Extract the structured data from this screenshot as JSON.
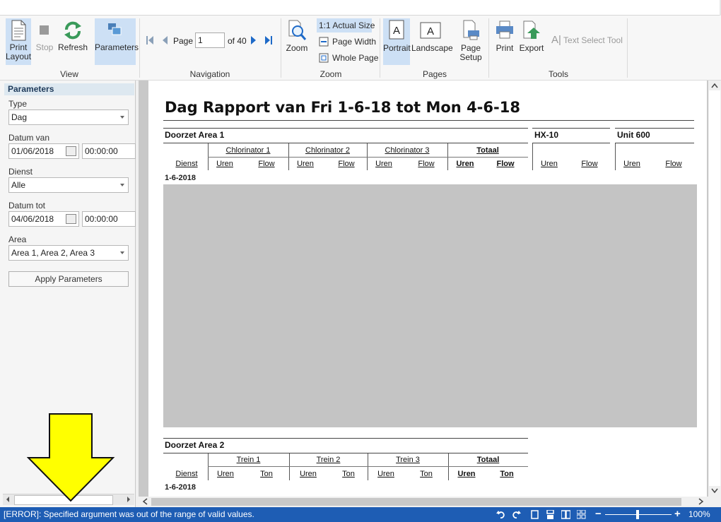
{
  "ribbon": {
    "groups": {
      "view": "View",
      "navigation": "Navigation",
      "zoom": "Zoom",
      "pages": "Pages",
      "tools": "Tools"
    },
    "print_layout_l1": "Print",
    "print_layout_l2": "Layout",
    "stop": "Stop",
    "refresh": "Refresh",
    "parameters": "Parameters",
    "page_label": "Page",
    "page_value": "1",
    "page_of": "of 40",
    "zoom": "Zoom",
    "actual_size": "1:1 Actual Size",
    "page_width": "Page Width",
    "whole_page": "Whole Page",
    "portrait": "Portrait",
    "landscape": "Landscape",
    "page_setup_l1": "Page",
    "page_setup_l2": "Setup",
    "print": "Print",
    "export": "Export",
    "text_select": "Text Select Tool"
  },
  "params": {
    "header": "Parameters",
    "type_label": "Type",
    "type_value": "Dag",
    "datum_van_label": "Datum van",
    "datum_van_date": "01/06/2018",
    "datum_van_time": "00:00:00",
    "dienst_label": "Dienst",
    "dienst_value": "Alle",
    "datum_tot_label": "Datum tot",
    "datum_tot_date": "04/06/2018",
    "datum_tot_time": "00:00:00",
    "area_label": "Area",
    "area_value": "Area 1, Area 2, Area 3",
    "apply": "Apply Parameters"
  },
  "report": {
    "title": "Dag Rapport van Fri 1-6-18 tot Mon 4-6-18",
    "section1": {
      "title": "Doorzet Area 1",
      "hx": "HX-10",
      "unit": "Unit 600",
      "groups": [
        "Chlorinator 1",
        "Chlorinator 2",
        "Chlorinator 3",
        "Totaal"
      ],
      "dienst": "Dienst",
      "uren": "Uren",
      "flow": "Flow",
      "date": "1-6-2018"
    },
    "section2": {
      "title": "Doorzet Area 2",
      "groups": [
        "Trein 1",
        "Trein 2",
        "Trein 3",
        "Totaal"
      ],
      "dienst": "Dienst",
      "uren": "Uren",
      "ton": "Ton",
      "date": "1-6-2018"
    }
  },
  "status": {
    "message": "[ERROR]: Specified argument was out of the range of valid values.",
    "zoom": "100%"
  },
  "colors": {
    "statusbar": "#1e5db4",
    "active_button": "#cde0f5",
    "annotation_arrow": "#ffff00"
  }
}
